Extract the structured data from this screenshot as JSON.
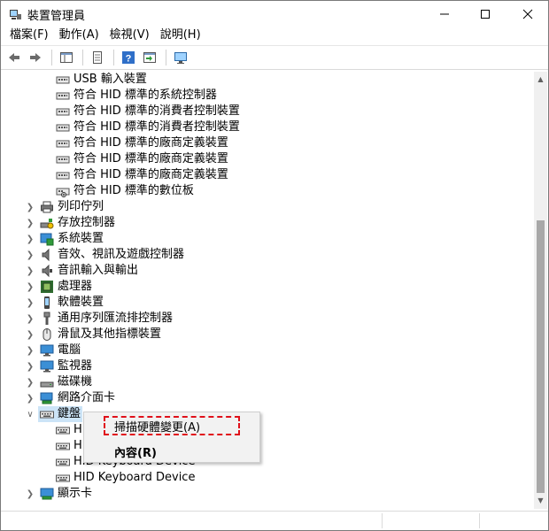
{
  "window": {
    "title": "裝置管理員"
  },
  "menu": [
    "檔案(F)",
    "動作(A)",
    "檢視(V)",
    "說明(H)"
  ],
  "tree": {
    "hid_children": [
      "USB 輸入裝置",
      "符合 HID 標準的系統控制器",
      "符合 HID 標準的消費者控制裝置",
      "符合 HID 標準的消費者控制裝置",
      "符合 HID 標準的廠商定義裝置",
      "符合 HID 標準的廠商定義裝置",
      "符合 HID 標準的廠商定義裝置",
      "符合 HID 標準的數位板"
    ],
    "categories": [
      "列印佇列",
      "存放控制器",
      "系統裝置",
      "音效、視訊及遊戲控制器",
      "音訊輸入與輸出",
      "處理器",
      "軟體裝置",
      "通用序列匯流排控制器",
      "滑鼠及其他指標裝置",
      "電腦",
      "監視器",
      "磁碟機",
      "網路介面卡",
      "鍵盤"
    ],
    "keyboard_children": [
      "H",
      "H",
      "HID Keyboard Device",
      "HID Keyboard Device"
    ],
    "last_category": "顯示卡"
  },
  "context_menu": {
    "scan": "掃描硬體變更(A)",
    "properties": "內容(R)"
  }
}
